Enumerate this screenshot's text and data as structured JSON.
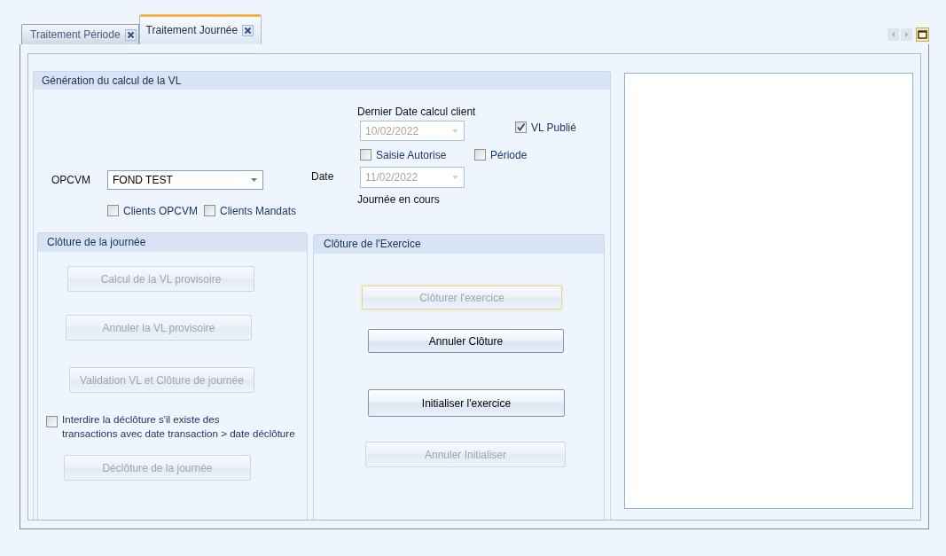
{
  "tabs": [
    {
      "label": "Traitement Période",
      "selected": false
    },
    {
      "label": "Traitement Journée",
      "selected": true
    }
  ],
  "generation_group": {
    "title": "Génération du calcul de la VL",
    "last_calc_date": {
      "label": "Dernier Date calcul client",
      "value": "10/02/2022",
      "disabled": true
    },
    "vl_publie": {
      "label": "VL Publié",
      "checked": true
    },
    "saisie_autorise": {
      "label": "Saisie Autorise",
      "checked": false
    },
    "periode": {
      "label": "Période",
      "checked": false
    },
    "opcvm": {
      "label": "OPCVM",
      "value": "FOND TEST"
    },
    "date": {
      "label": "Date",
      "value": "11/02/2022",
      "disabled": true,
      "caption": "Journée en cours"
    },
    "client_filters": [
      {
        "label": "Clients OPCVM",
        "checked": false
      },
      {
        "label": "Clients Mandats",
        "checked": false
      }
    ]
  },
  "day_closing": {
    "title": "Clôture de la journée",
    "items": [
      {
        "kind": "button",
        "label": "Calcul de la VL provisoire",
        "disabled": true
      },
      {
        "kind": "button",
        "label": "Annuler la VL provisoire",
        "disabled": true
      },
      {
        "kind": "button",
        "label": "Validation VL et Clôture de journée",
        "disabled": true
      },
      {
        "kind": "checkbox",
        "label": "Interdire la déclôture s'il existe des\ntransactions avec date transaction > date déclôture",
        "checked": false
      },
      {
        "kind": "button",
        "label": "Déclôture de la journée",
        "disabled": true
      }
    ]
  },
  "year_closing": {
    "title": "Clôture de l'Exercice",
    "buttons": [
      {
        "label": "Clôturer l'exercice",
        "disabled": true,
        "focused": true
      },
      {
        "label": "Annuler Clôture",
        "disabled": false,
        "focused": false
      },
      {
        "label": "Initialiser l'exercice",
        "disabled": false,
        "focused": false
      },
      {
        "label": "Annuler Initialiser",
        "disabled": true,
        "focused": false
      }
    ]
  }
}
